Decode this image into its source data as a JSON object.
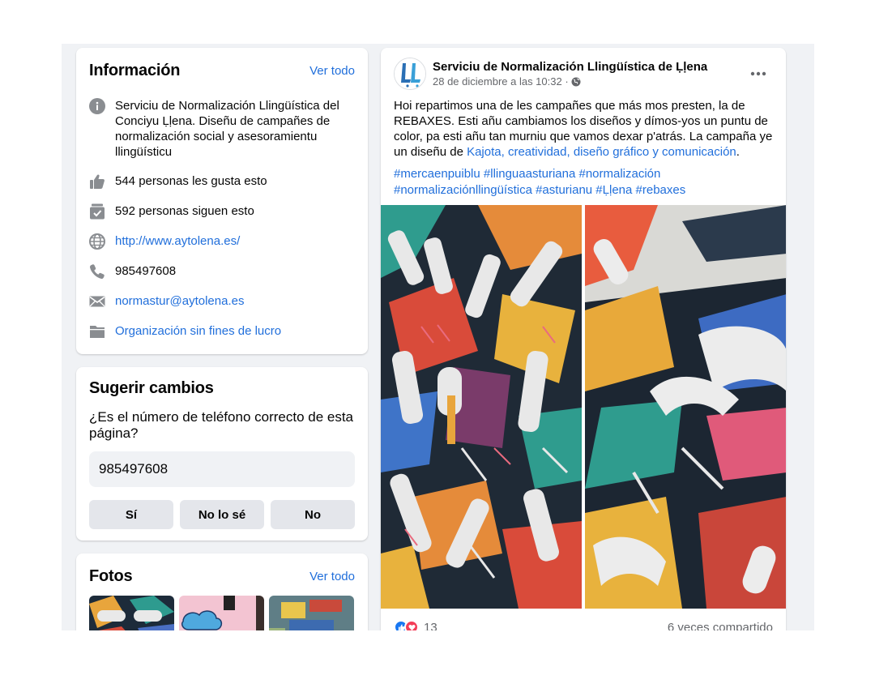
{
  "info": {
    "title": "Información",
    "see_all": "Ver todo",
    "description": "Serviciu de Normalización Llingüística del Conciyu Ḷḷena. Diseñu de campañes de normalización social y asesoramientu llingüísticu",
    "likes": "544 personas les gusta esto",
    "followers": "592 personas siguen esto",
    "website": "http://www.aytolena.es/",
    "phone": "985497608",
    "email": "normastur@aytolena.es",
    "category": "Organización sin fines de lucro"
  },
  "suggest": {
    "title": "Sugerir cambios",
    "question": "¿Es el número de teléfono correcto de esta página?",
    "phone": "985497608",
    "yes": "Sí",
    "dont_know": "No lo sé",
    "no": "No"
  },
  "photos": {
    "title": "Fotos",
    "see_all": "Ver todo"
  },
  "post": {
    "author": "Serviciu de Normalización Llingüística de Ḷḷena",
    "time": "28 de diciembre a las 10:32 ·",
    "privacy_icon": "globe-icon",
    "text_main": "Hoi repartimos una de les campañes que más mos presten, la de REBAXES. Esti añu cambiamos los diseños y dímos-yos un puntu de color, pa esti añu tan murniu que vamos dexar p'atrás. La campaña ye un diseñu de ",
    "text_link": "Kajota, creatividad, diseño gráfico y comunicación",
    "text_end": ".",
    "hashtags": "#mercaenpuiblu #llinguaasturiana #normalización #normalizaciónllingüística #asturianu #Ḷḷena #rebaxes",
    "reactions_count": "13",
    "shares": "6 veces compartido"
  },
  "colors": {
    "link": "#216fdb",
    "background": "#f0f2f5",
    "like_blue": "#1877f2",
    "love_red": "#f33e58"
  }
}
